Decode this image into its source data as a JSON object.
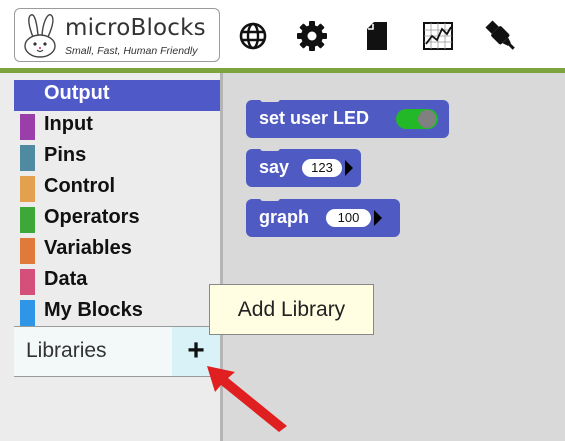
{
  "app": {
    "title": "microBlocks",
    "subtitle": "Small, Fast, Human Friendly"
  },
  "toolbar": {
    "icons": [
      "globe-icon",
      "gear-icon",
      "file-icon",
      "graph-icon",
      "usb-plug-icon"
    ]
  },
  "categories": [
    {
      "label": "Output",
      "color": "#4f5ac3",
      "selected": true
    },
    {
      "label": "Input",
      "color": "#9a3fa9"
    },
    {
      "label": "Pins",
      "color": "#4e8aa0"
    },
    {
      "label": "Control",
      "color": "#e3a04e"
    },
    {
      "label": "Operators",
      "color": "#3ea73a"
    },
    {
      "label": "Variables",
      "color": "#e07a3a"
    },
    {
      "label": "Data",
      "color": "#d4507a"
    },
    {
      "label": "My Blocks",
      "color": "#2f95e6"
    }
  ],
  "libraries": {
    "label": "Libraries",
    "add_symbol": "+"
  },
  "blocks": [
    {
      "label": "set user LED",
      "toggle_on": true
    },
    {
      "label": "say",
      "value": "123"
    },
    {
      "label": "graph",
      "value": "100"
    }
  ],
  "tooltip": "Add Library",
  "colors": {
    "accent_green": "#7da33f",
    "block_blue": "#4f5ac3",
    "annotation_arrow": "#e02020"
  }
}
